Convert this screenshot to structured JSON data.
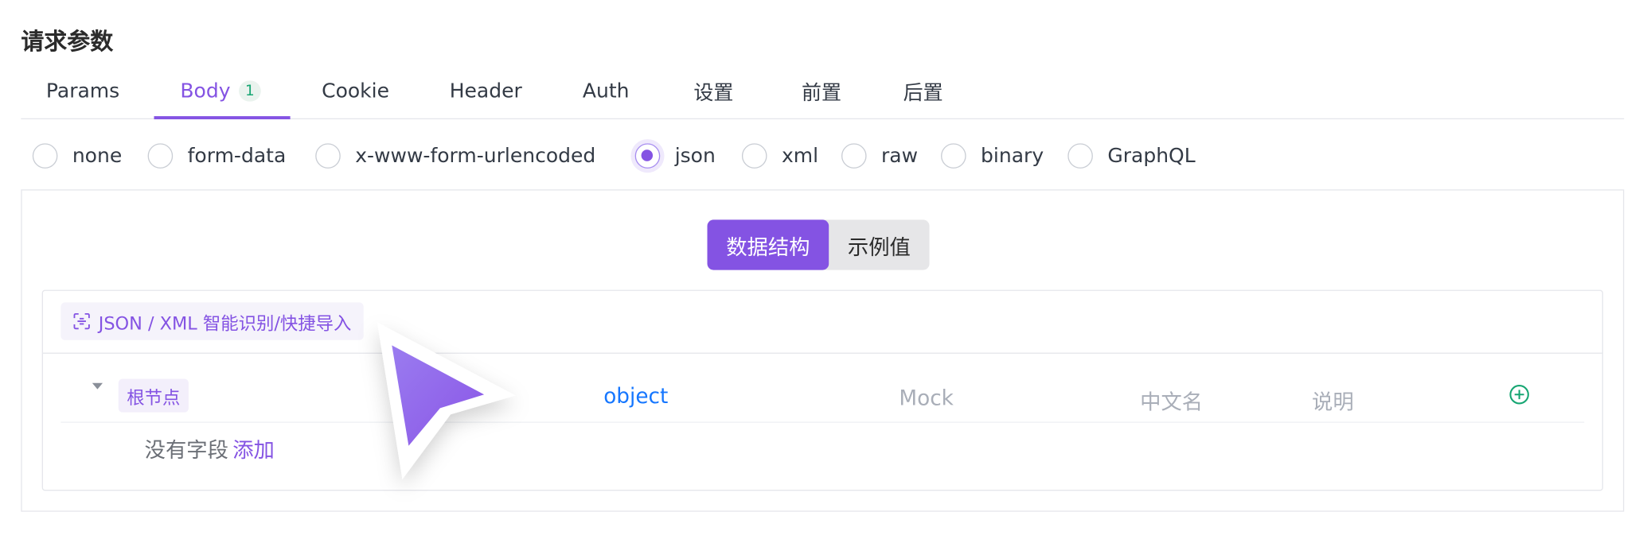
{
  "section_title": "请求参数",
  "tabs": [
    {
      "label": "Params"
    },
    {
      "label": "Body",
      "badge": "1",
      "active": true
    },
    {
      "label": "Cookie"
    },
    {
      "label": "Header"
    },
    {
      "label": "Auth"
    },
    {
      "label": "设置"
    },
    {
      "label": "前置"
    },
    {
      "label": "后置"
    }
  ],
  "body_types": [
    {
      "label": "none"
    },
    {
      "label": "form-data"
    },
    {
      "label": "x-www-form-urlencoded"
    },
    {
      "label": "json",
      "checked": true
    },
    {
      "label": "xml"
    },
    {
      "label": "raw"
    },
    {
      "label": "binary"
    },
    {
      "label": "GraphQL"
    }
  ],
  "view_switch": {
    "structure": "数据结构",
    "example": "示例值",
    "active": "structure"
  },
  "import_button": "JSON / XML 智能识别/快捷导入",
  "root_row": {
    "name": "根节点",
    "type": "object",
    "mock_placeholder": "Mock",
    "cn_name_placeholder": "中文名",
    "desc_placeholder": "说明"
  },
  "empty_state": {
    "text": "没有字段",
    "add_link": "添加"
  },
  "colors": {
    "accent": "#8453e3",
    "link": "#1677ff",
    "add": "#17a673"
  },
  "icons": [
    "scan-import-icon",
    "caret-down-icon",
    "add-circle-icon",
    "mouse-cursor-icon"
  ]
}
